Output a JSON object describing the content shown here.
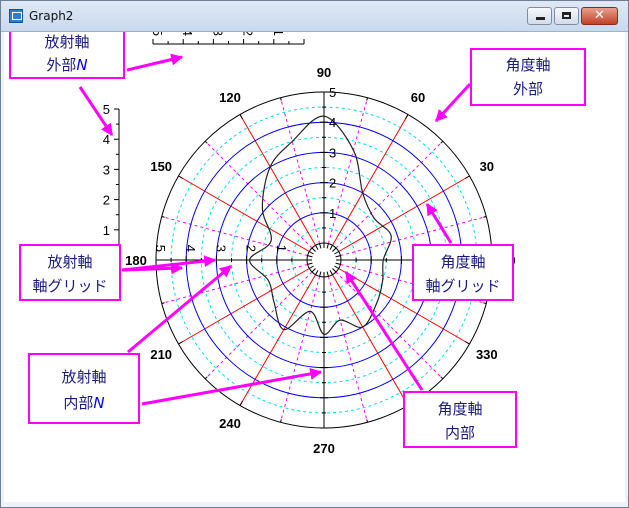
{
  "window": {
    "title": "Graph2",
    "close_glyph": "✕"
  },
  "angle_labels": [
    "0",
    "30",
    "60",
    "90",
    "120",
    "150",
    "180",
    "210",
    "240",
    "270",
    "300",
    "330"
  ],
  "radial_labels": [
    "1",
    "2",
    "3",
    "4",
    "5"
  ],
  "callouts": {
    "radial_outer": {
      "line1": "放射軸",
      "line2": "外部",
      "suffix": "N"
    },
    "angular_outer": {
      "line1": "角度軸",
      "line2": "外部"
    },
    "radial_grid": {
      "line1": "放射軸",
      "line2": "軸グリッド"
    },
    "angular_grid": {
      "line1": "角度軸",
      "line2": "軸グリッド"
    },
    "radial_inner": {
      "line1": "放射軸",
      "line2": "内部",
      "suffix": "N"
    },
    "angular_inner": {
      "line1": "角度軸",
      "line2": "内部"
    }
  },
  "colors": {
    "major_circle": "#0000ff",
    "minor_circle": "#00e0e0",
    "major_spoke": "#ff0000",
    "minor_spoke": "#ff00ff",
    "callout_arrow": "#ff00ff",
    "callout_text": "#1a1a80"
  },
  "chart_data": {
    "type": "line",
    "coordinate_system": "polar",
    "radial_range": [
      0,
      5
    ],
    "angular_range": [
      0,
      360
    ],
    "angular_major_step": 30,
    "series": [
      {
        "theta": [
          0,
          20,
          40,
          60,
          75,
          90,
          105,
          120,
          140,
          160,
          180,
          200,
          220,
          240,
          255,
          270,
          285,
          300,
          320,
          340,
          360
        ],
        "r": [
          1.4,
          1.8,
          1.6,
          2.0,
          3.2,
          4.2,
          3.5,
          3.0,
          2.1,
          1.3,
          1.9,
          1.4,
          1.6,
          2.1,
          1.2,
          1.9,
          1.5,
          2.0,
          1.7,
          1.5,
          1.4
        ]
      }
    ]
  }
}
